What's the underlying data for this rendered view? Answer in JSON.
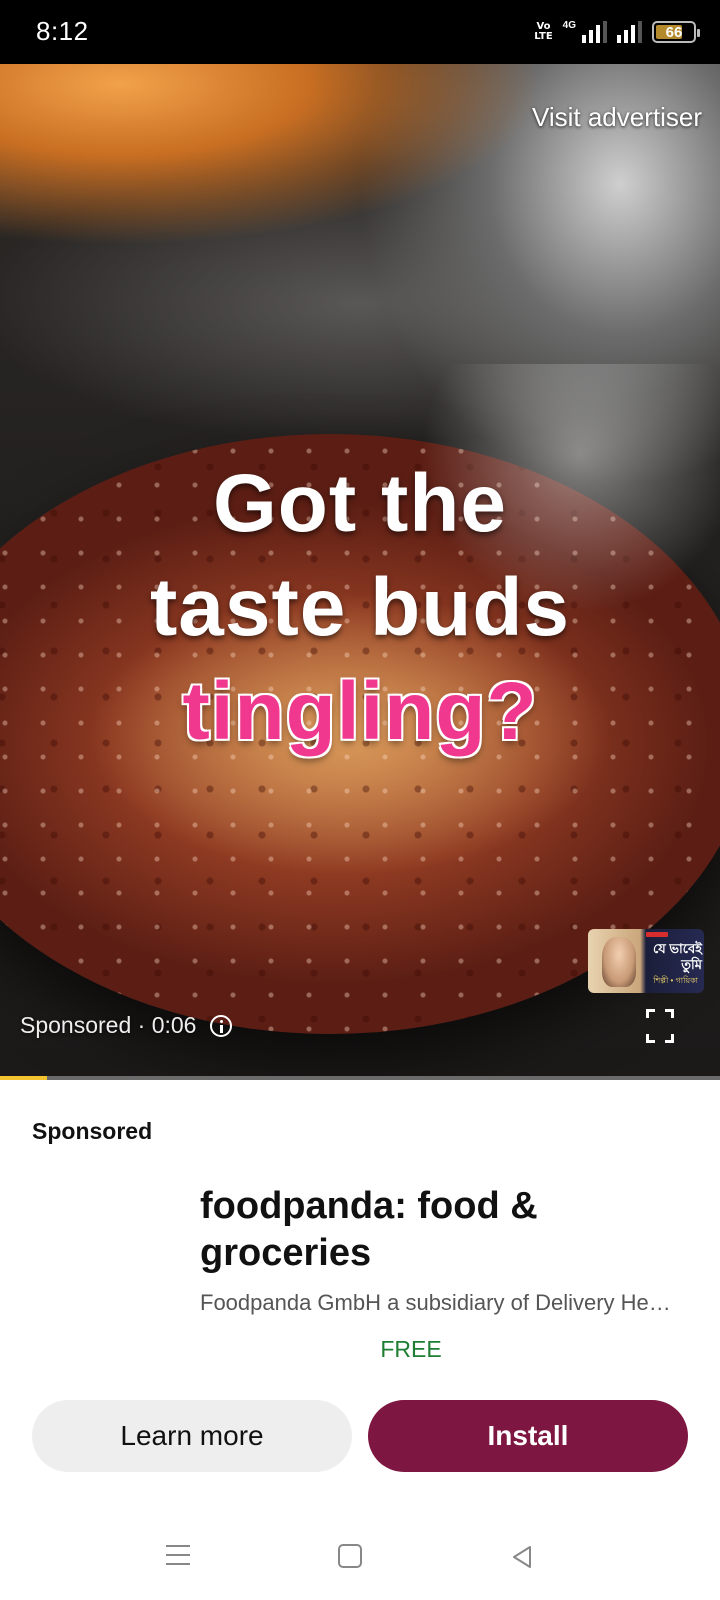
{
  "status_bar": {
    "time": "8:12",
    "network_label": "4G",
    "volte_line1": "Vo",
    "volte_line2": "LTE",
    "battery_level": "66"
  },
  "video": {
    "visit_advertiser": "Visit advertiser",
    "headline": {
      "line1": "Got the",
      "line2": "taste buds",
      "line3": "tingling?"
    },
    "sponsored_time": "Sponsored · 0:06",
    "progress_fraction": 0.065,
    "mini_thumbnail": {
      "title": "যে ভাবেই তুমি",
      "subtitle": "শিল্পী • গায়িকা"
    }
  },
  "ad": {
    "label": "Sponsored",
    "app_title": "foodpanda: food & groceries",
    "publisher": "Foodpanda GmbH a subsidiary of Delivery He…",
    "price": "FREE",
    "learn_more": "Learn more",
    "install": "Install"
  },
  "colors": {
    "install_button": "#7d1640",
    "price_text": "#1e7e34",
    "headline_accent": "#f0398e",
    "progress": "#f4c430"
  },
  "icons": {
    "info": "info-icon",
    "fullscreen": "fullscreen-icon",
    "nav_menu": "menu-icon",
    "nav_home": "home-icon",
    "nav_back": "back-icon"
  }
}
